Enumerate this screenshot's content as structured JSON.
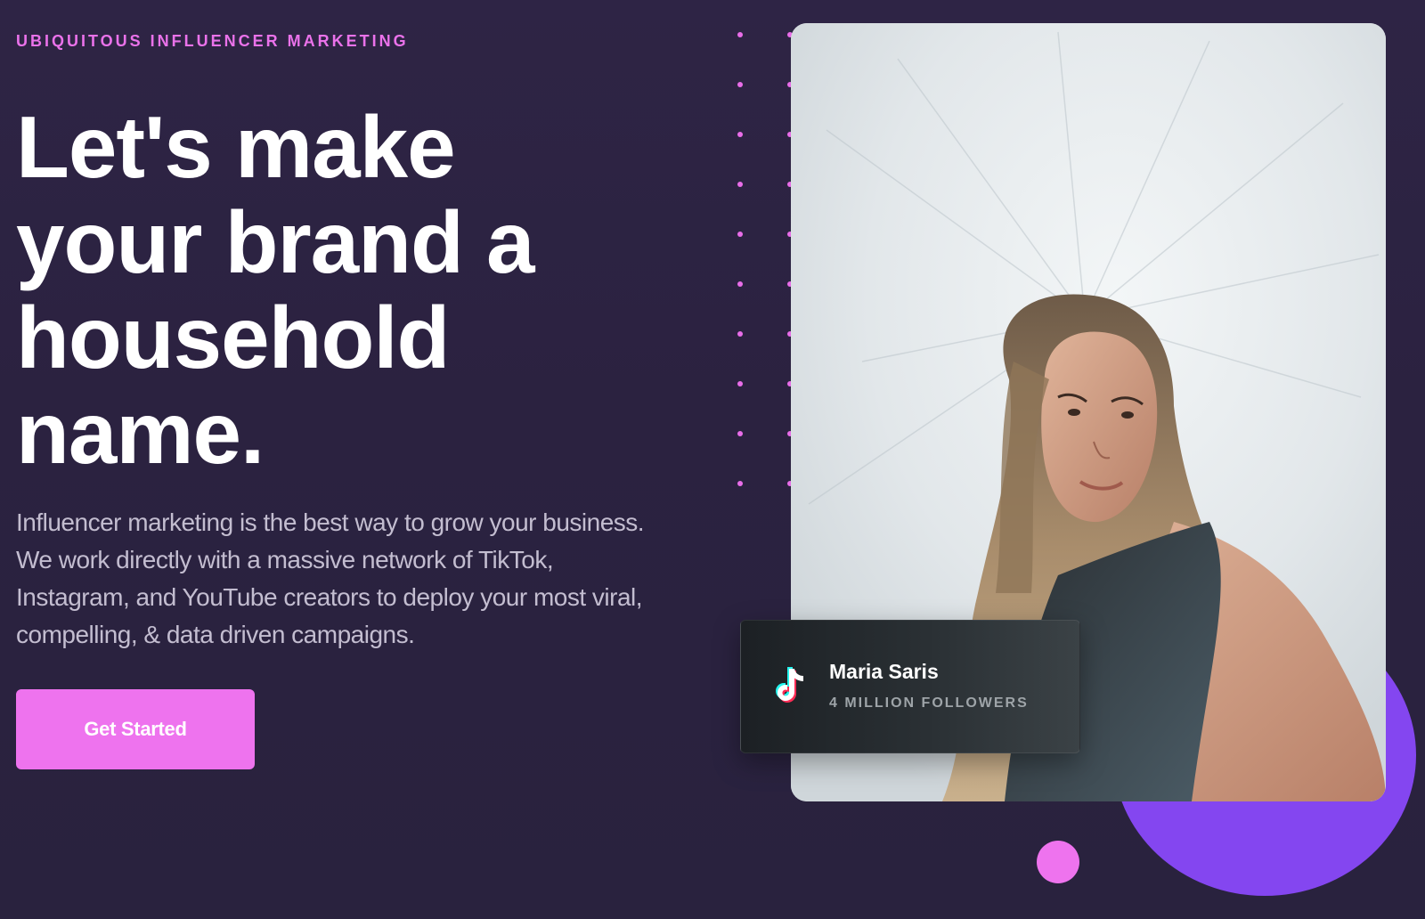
{
  "hero": {
    "eyebrow": "UBIQUITOUS INFLUENCER MARKETING",
    "headline_lines": [
      "Let's make",
      "your brand a",
      "household",
      "name."
    ],
    "description": "Influencer marketing is the best way to grow your business. We work directly with a massive network of TikTok, Instagram, and YouTube creators to deploy your most viral, compelling, & data driven campaigns.",
    "cta_label": "Get Started"
  },
  "influencer_card": {
    "platform_icon": "tiktok-icon",
    "name": "Maria Saris",
    "followers": "4 MILLION FOLLOWERS"
  },
  "colors": {
    "background": "#2b2240",
    "accent_pink": "#ee73ee",
    "accent_purple": "#8446f0",
    "eyebrow": "#ea72ea"
  },
  "photo_icon": "woman-portrait-image"
}
